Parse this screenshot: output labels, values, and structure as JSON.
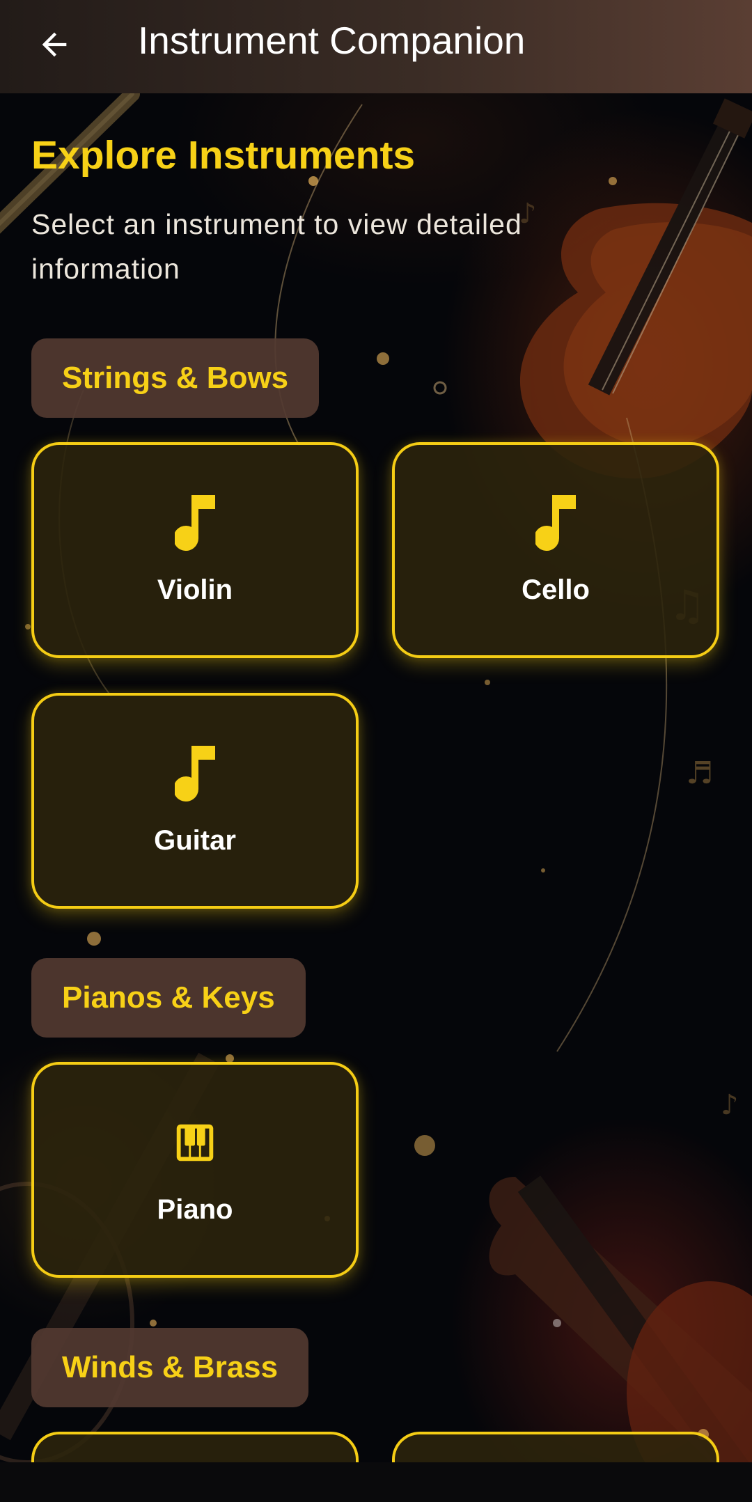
{
  "appbar": {
    "title": "Instrument Companion",
    "back_icon": "arrow-left-icon"
  },
  "page": {
    "title": "Explore Instruments",
    "subtitle": "Select an instrument to view detailed information"
  },
  "sections": [
    {
      "title": "Strings & Bows",
      "instruments": [
        {
          "label": "Violin",
          "icon": "music-note-icon"
        },
        {
          "label": "Cello",
          "icon": "music-note-icon"
        },
        {
          "label": "Guitar",
          "icon": "music-note-icon"
        }
      ]
    },
    {
      "title": "Pianos & Keys",
      "instruments": [
        {
          "label": "Piano",
          "icon": "piano-icon"
        }
      ]
    },
    {
      "title": "Winds & Brass",
      "instruments": []
    }
  ],
  "colors": {
    "accent": "#f7d117",
    "chip_bg": "#523a31",
    "card_bg": "#2c240c",
    "appbar_start": "#221b18",
    "appbar_end": "#5a3e33"
  }
}
